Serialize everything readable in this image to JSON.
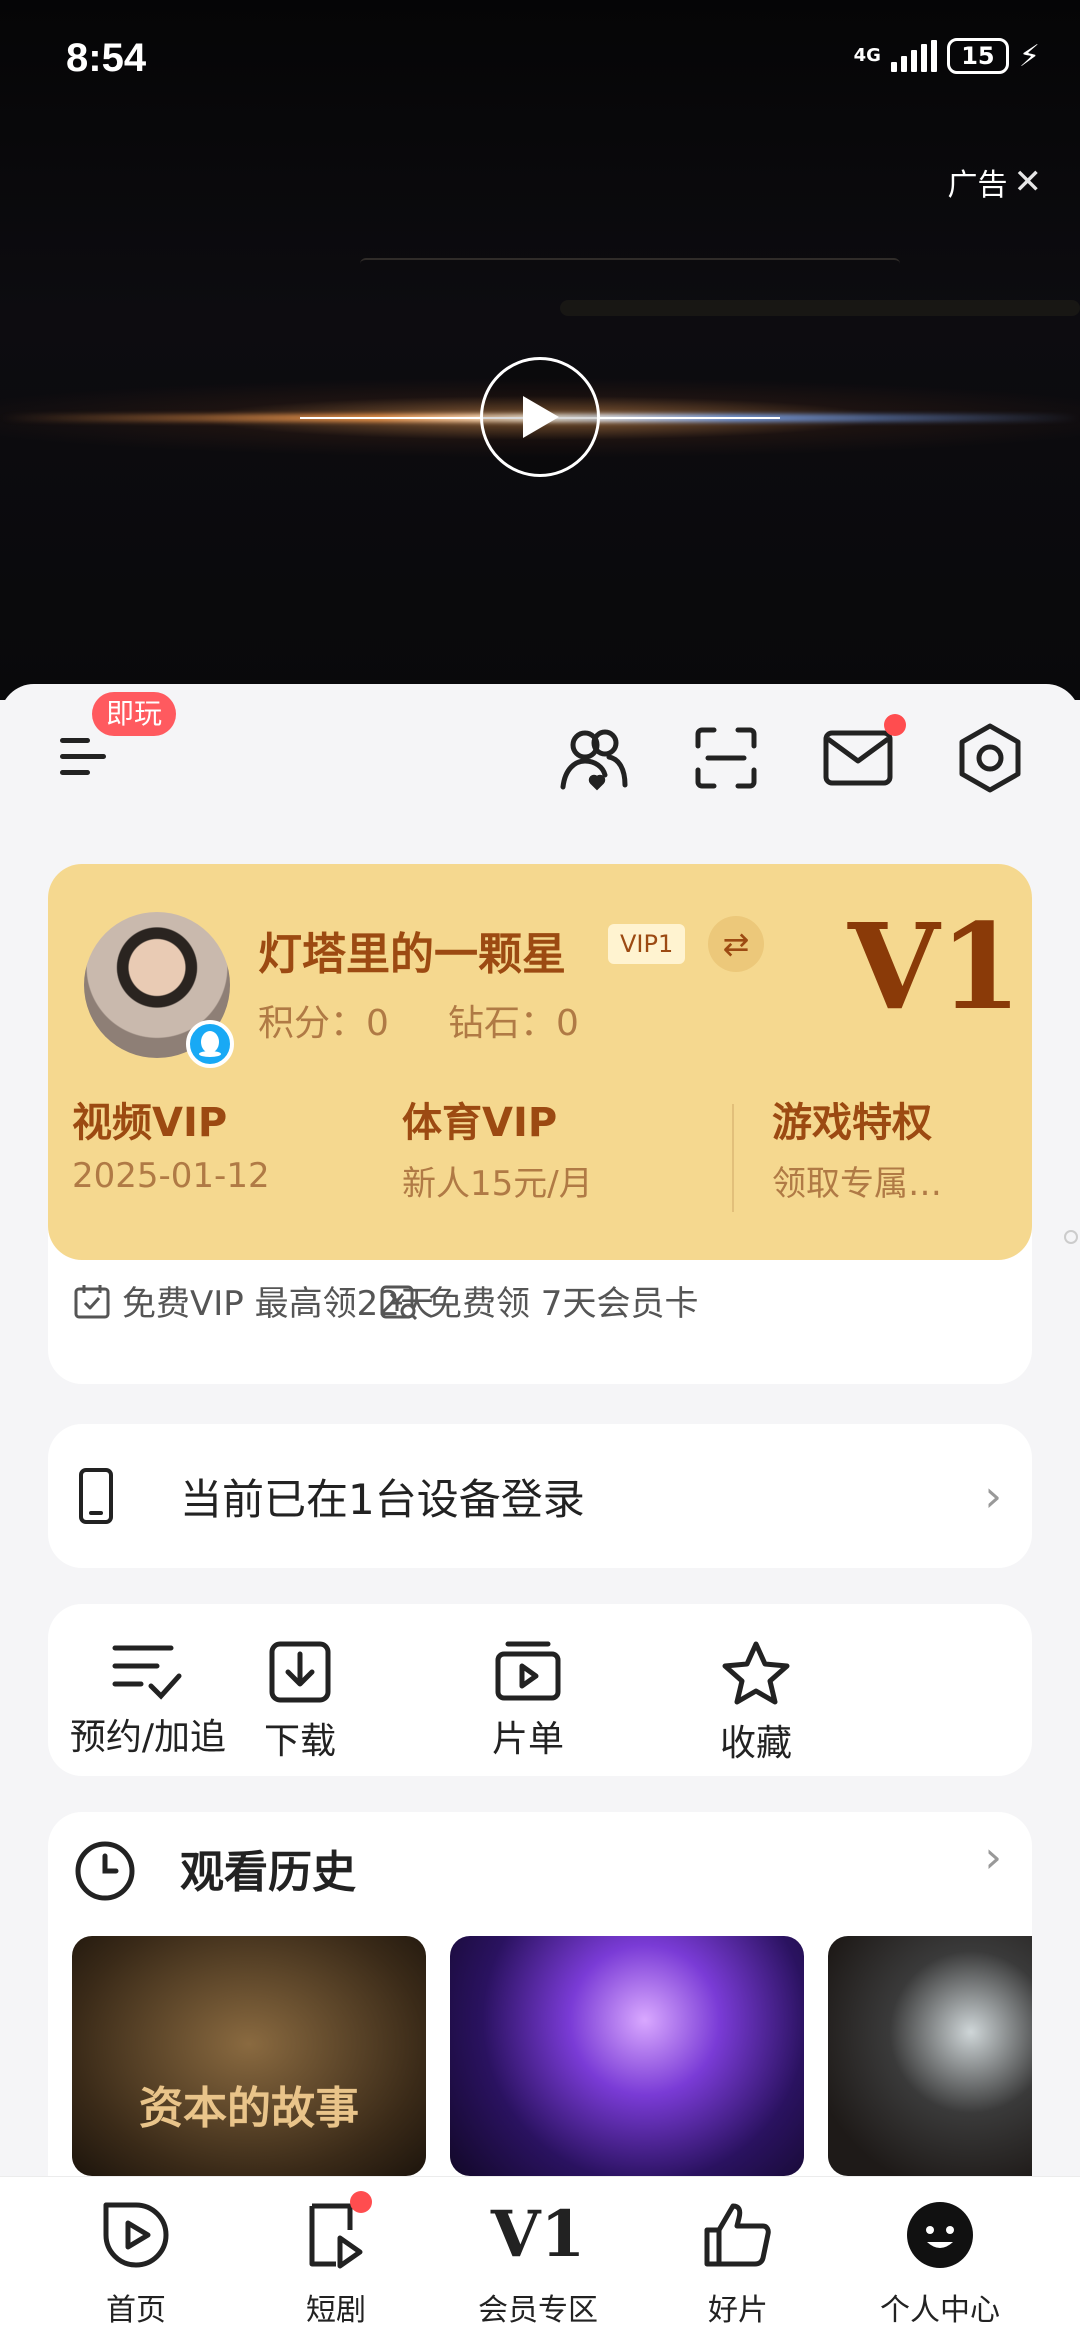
{
  "status_bar": {
    "time": "8:54",
    "network": "4G",
    "battery": "15"
  },
  "ad": {
    "label": "广告"
  },
  "toolbar": {
    "play_badge": "即玩"
  },
  "member_card": {
    "username": "灯塔里的一颗星",
    "vip_tag": "VIP1",
    "points": "积分：0",
    "diamonds": "钻石：0",
    "level": "V1",
    "perks": [
      {
        "title": "视频VIP",
        "subtitle": "2025-01-12"
      },
      {
        "title": "体育VIP",
        "subtitle": "新人15元/月"
      },
      {
        "title": "游戏特权",
        "subtitle": "领取专属…"
      }
    ],
    "promos": [
      {
        "text": "免费VIP 最高领22天"
      },
      {
        "text": "免费领 7天会员卡"
      }
    ]
  },
  "device_login": {
    "text": "当前已在1台设备登录"
  },
  "shortcuts": [
    {
      "label": "预约/加追",
      "icon": "list-check-icon"
    },
    {
      "label": "下载",
      "icon": "download-icon"
    },
    {
      "label": "片单",
      "icon": "playlist-icon"
    },
    {
      "label": "收藏",
      "icon": "star-icon"
    }
  ],
  "history": {
    "title": "观看历史",
    "items": [
      {
        "caption": "资本的故事"
      },
      {
        "caption": ""
      },
      {
        "caption": ""
      }
    ]
  },
  "bottom_nav": [
    {
      "label": "首页",
      "icon": "home-play-icon"
    },
    {
      "label": "短剧",
      "icon": "short-drama-icon"
    },
    {
      "label": "会员专区",
      "icon": "vip-zone-icon",
      "glyph": "V1"
    },
    {
      "label": "好片",
      "icon": "thumbs-up-icon"
    },
    {
      "label": "个人中心",
      "icon": "profile-icon"
    }
  ],
  "colors": {
    "gold": "#f5d88f",
    "brown": "#9c4a12",
    "red_dot": "#ff4d4f",
    "badge": "#ff5a5f"
  }
}
